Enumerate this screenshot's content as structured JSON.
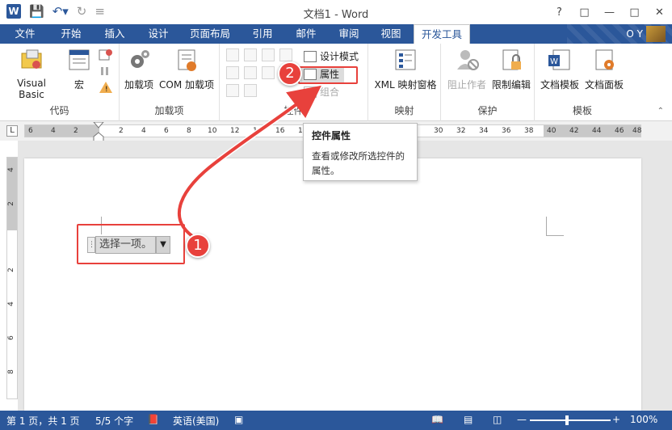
{
  "title_bar": {
    "title": "文档1 - Word",
    "logo": "W",
    "help": "?",
    "controls": [
      "restore-ribbon",
      "minimize",
      "maximize",
      "close"
    ]
  },
  "tabs": {
    "file": "文件",
    "items": [
      "开始",
      "插入",
      "设计",
      "页面布局",
      "引用",
      "邮件",
      "审阅",
      "视图",
      "开发工具"
    ],
    "active": "开发工具",
    "user": "O Y"
  },
  "ribbon": {
    "code": {
      "label": "代码",
      "vba": "Visual Basic",
      "macro": "宏"
    },
    "addins": {
      "label": "加载项",
      "addins_btn": "加载项",
      "com_btn": "COM 加载项"
    },
    "controls": {
      "label": "控件",
      "design_mode": "设计模式",
      "properties": "属性",
      "group": "组合"
    },
    "mapping": {
      "label": "映射",
      "xml_pane": "XML 映射窗格"
    },
    "protect": {
      "label": "保护",
      "block_authors": "阻止作者",
      "restrict": "限制编辑"
    },
    "templates": {
      "label": "模板",
      "doc_template": "文档模板",
      "doc_panel": "文档面板"
    }
  },
  "ruler": {
    "corner": "L",
    "numbers": [
      "6",
      "4",
      "2",
      "2",
      "4",
      "6",
      "8",
      "10",
      "12",
      "14",
      "16",
      "18",
      "30",
      "32",
      "34",
      "36",
      "38",
      "40",
      "42",
      "44",
      "46",
      "48"
    ],
    "vnumbers": [
      "4",
      "2",
      "2",
      "4",
      "6",
      "8"
    ]
  },
  "tooltip": {
    "title": "控件属性",
    "body": "查看或修改所选控件的属性。"
  },
  "document": {
    "content_control_text": "选择一项。"
  },
  "annotations": {
    "badge1": "1",
    "badge2": "2",
    "color": "#e8413c"
  },
  "status_bar": {
    "page": "第 1 页，共 1 页",
    "words": "5/5 个字",
    "language": "英语(美国)",
    "zoom": "100%"
  },
  "colors": {
    "accent": "#2b579a"
  }
}
